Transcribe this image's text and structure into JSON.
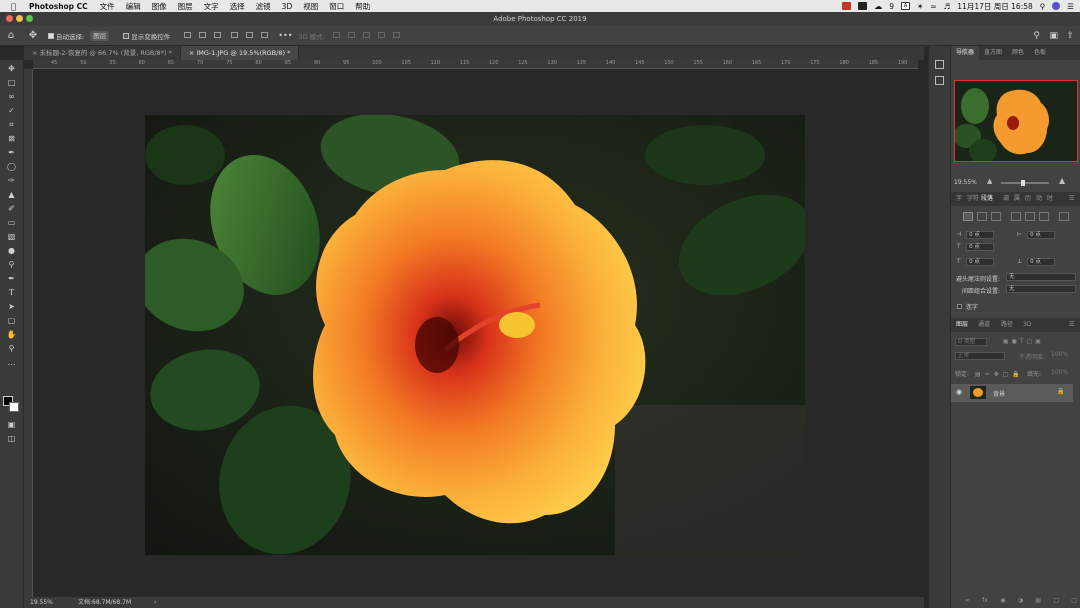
{
  "menubar": {
    "app_name": "Photoshop CC",
    "items": [
      "文件",
      "编辑",
      "图像",
      "图层",
      "文字",
      "选择",
      "滤镜",
      "3D",
      "视图",
      "窗口",
      "帮助"
    ],
    "status_wechat_count": "9",
    "status_input": "A",
    "clock": "11月17日 周日 16:58"
  },
  "titlebar": {
    "title": "Adobe Photoshop CC 2019"
  },
  "options": {
    "auto_select_label": "自动选择:",
    "auto_select_value": "图层",
    "show_transform_label": "显示变换控件",
    "mode_3d_label": "3D 模式:",
    "more": "•••"
  },
  "tabs": [
    {
      "label": "未标题-2-恢复的 @ 66.7% (背景, RGB/8*) *"
    },
    {
      "label": "IMG-1.JPG @ 19.5%(RGB/8) *"
    }
  ],
  "ruler": {
    "labels": [
      "45",
      "50",
      "55",
      "60",
      "65",
      "70",
      "75",
      "80",
      "85",
      "90",
      "95",
      "100",
      "105",
      "110",
      "115",
      "120",
      "125",
      "130",
      "135",
      "140",
      "145",
      "150",
      "155",
      "160",
      "165",
      "170",
      "175",
      "180",
      "185",
      "190"
    ]
  },
  "status": {
    "zoom": "19.55%",
    "doc": "文档:68.7M/68.7M",
    "arrow": "›"
  },
  "navigator": {
    "tabs": [
      "导航器",
      "直方图",
      "颜色",
      "色板"
    ],
    "zoom": "19.55%"
  },
  "paragraph": {
    "tabs": [
      "字",
      "字符",
      "段落"
    ],
    "side_icons": [
      "调",
      "属",
      "历",
      "动",
      "时"
    ],
    "indent_left": "0 点",
    "indent_right": "0 点",
    "indent_first": "0 点",
    "space_before": "0 点",
    "space_after": "0 点",
    "hanging_label": "避头尾法则设置:",
    "hanging_value": "无",
    "composer_label": "间距组合设置:",
    "composer_value": "无",
    "hyphenate_label": "连字"
  },
  "layers": {
    "tabs": [
      "图层",
      "通道",
      "路径",
      "3D"
    ],
    "kind": "Q 类型",
    "blend": "正常",
    "opacity_label": "不透明度:",
    "opacity_value": "100%",
    "lock_label": "锁定:",
    "fill_label": "填充:",
    "fill_value": "100%",
    "layer_name": "背景"
  }
}
